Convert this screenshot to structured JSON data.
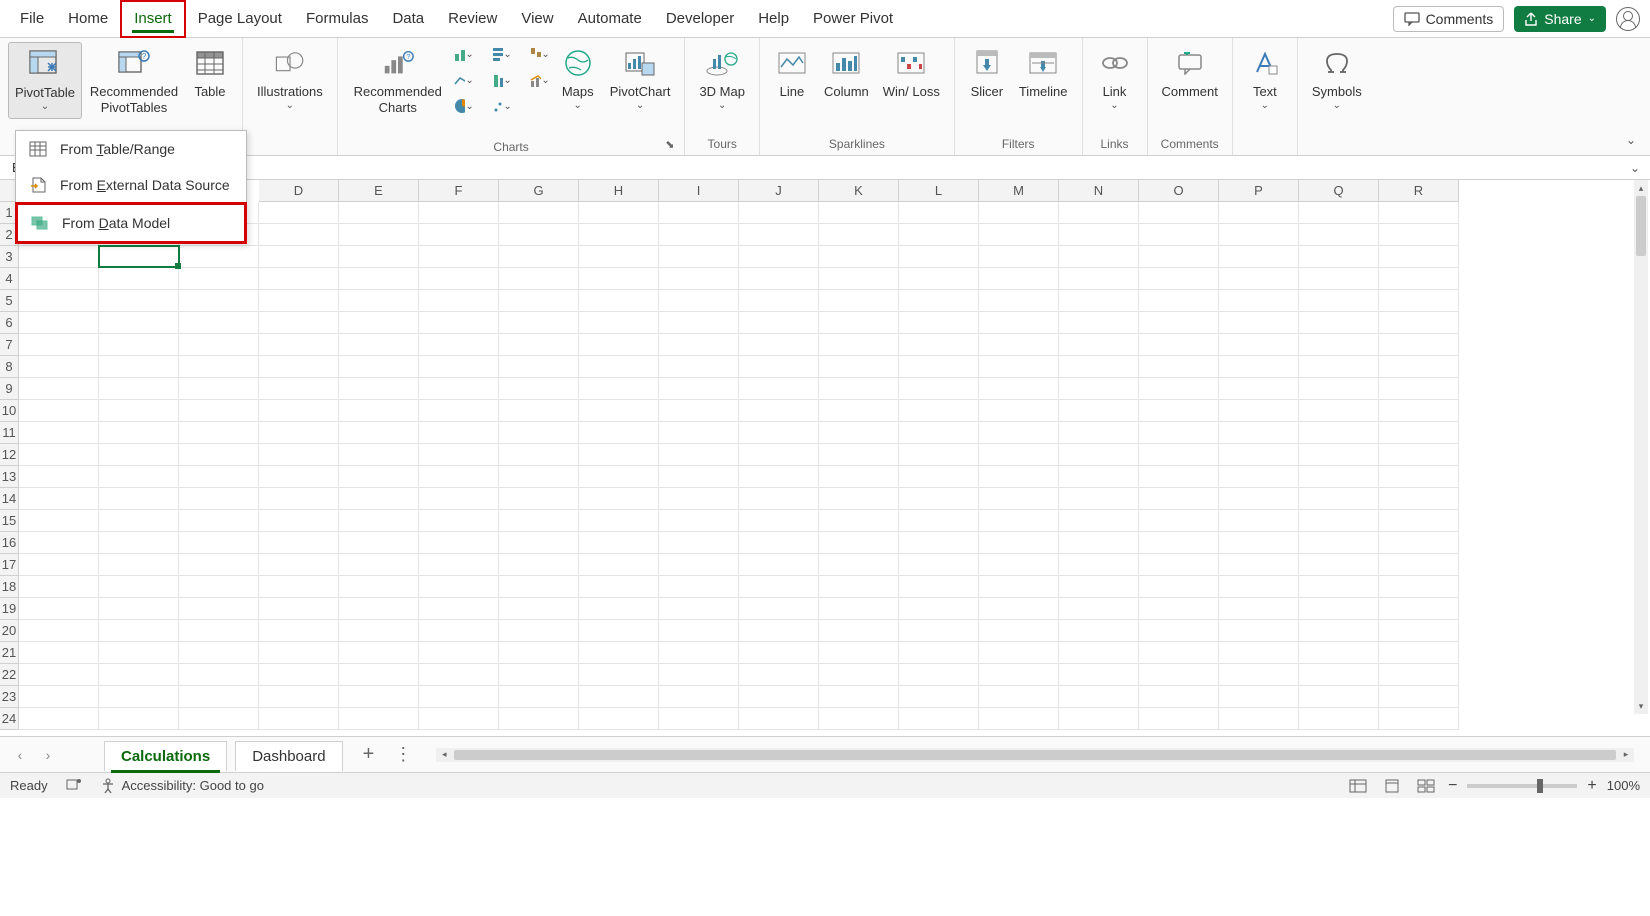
{
  "tabs": {
    "file": "File",
    "home": "Home",
    "insert": "Insert",
    "page_layout": "Page Layout",
    "formulas": "Formulas",
    "data": "Data",
    "review": "Review",
    "view": "View",
    "automate": "Automate",
    "developer": "Developer",
    "help": "Help",
    "power_pivot": "Power Pivot"
  },
  "top_right": {
    "comments": "Comments",
    "share": "Share"
  },
  "ribbon": {
    "pivot_table": "PivotTable",
    "recommended_pivot": "Recommended PivotTables",
    "table": "Table",
    "illustrations": "Illustrations",
    "recommended_charts": "Recommended Charts",
    "maps": "Maps",
    "pivot_chart": "PivotChart",
    "threeD_map": "3D Map",
    "line": "Line",
    "column": "Column",
    "winloss": "Win/ Loss",
    "slicer": "Slicer",
    "timeline": "Timeline",
    "link": "Link",
    "comment": "Comment",
    "text": "Text",
    "symbols": "Symbols",
    "groups": {
      "charts": "Charts",
      "tours": "Tours",
      "sparklines": "Sparklines",
      "filters": "Filters",
      "links": "Links",
      "comments": "Comments"
    }
  },
  "dropdown": {
    "table_range_pre": "From ",
    "table_range_u": "T",
    "table_range_post": "able/Range",
    "external_pre": "From ",
    "external_u": "E",
    "external_post": "xternal Data Source",
    "data_model_pre": "From ",
    "data_model_u": "D",
    "data_model_post": "ata Model"
  },
  "name_box": "B",
  "columns": [
    "D",
    "E",
    "F",
    "G",
    "H",
    "I",
    "J",
    "K",
    "L",
    "M",
    "N",
    "O",
    "P",
    "Q",
    "R"
  ],
  "rows": [
    "1",
    "2",
    "3",
    "4",
    "5",
    "6",
    "7",
    "8",
    "9",
    "10",
    "11",
    "12",
    "13",
    "14",
    "15",
    "16",
    "17",
    "18",
    "19",
    "20",
    "21",
    "22",
    "23",
    "24"
  ],
  "sheets": {
    "active": "Calculations",
    "other": "Dashboard"
  },
  "status": {
    "ready": "Ready",
    "accessibility": "Accessibility: Good to go",
    "zoom_minus": "−",
    "zoom_plus": "+",
    "zoom_value": "100%"
  }
}
